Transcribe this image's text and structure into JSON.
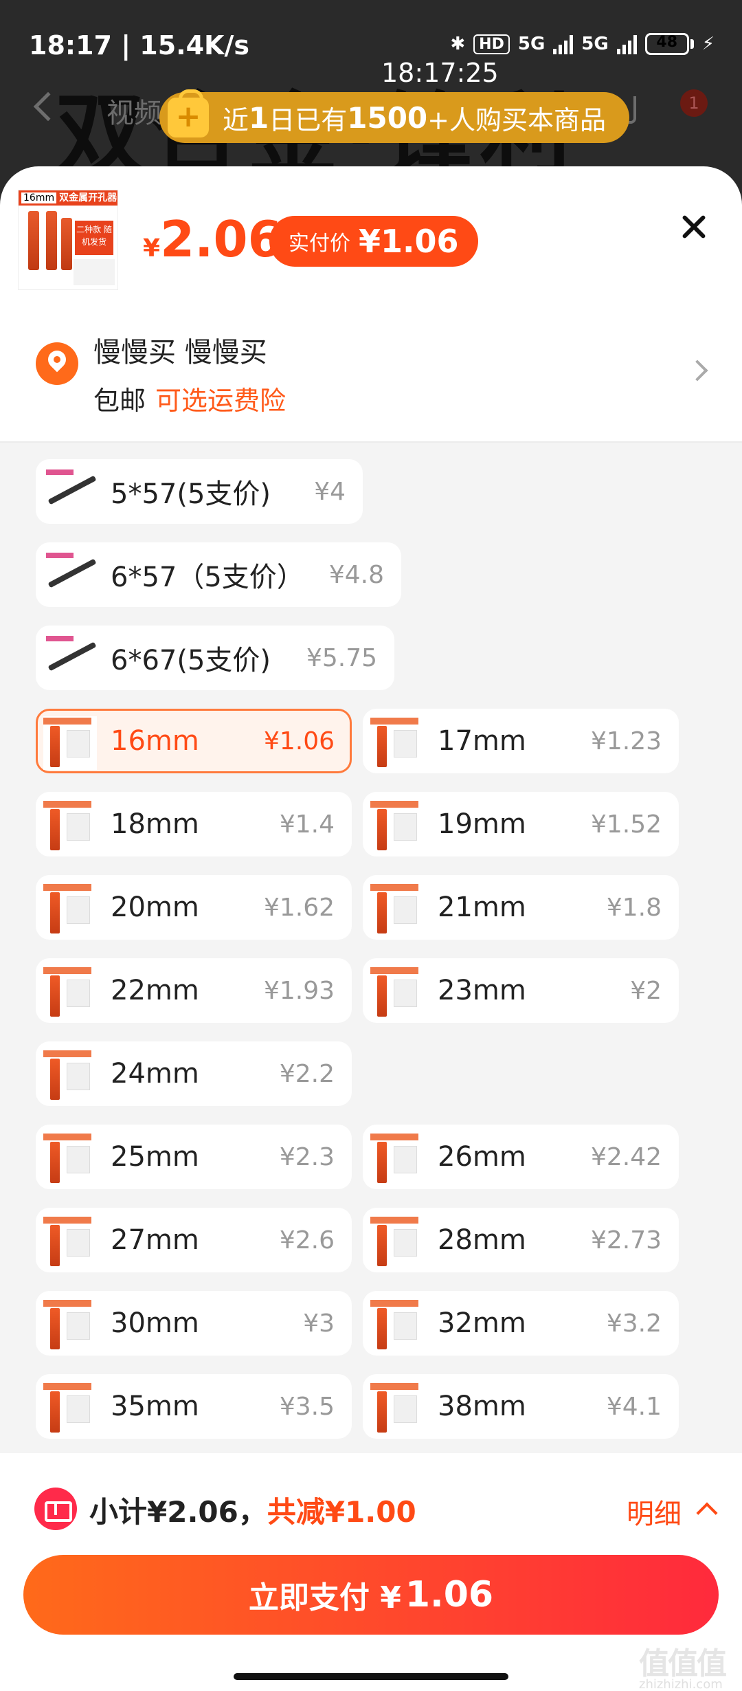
{
  "status_bar": {
    "time_speed": "18:17 | 15.4K/s",
    "clock": "18:17:25",
    "net1": "5G",
    "net2": "5G",
    "hd": "HD",
    "battery": "48"
  },
  "background": {
    "title": "双合金·锋利",
    "video_tab": "视频",
    "cart_badge": "1"
  },
  "banner": {
    "prefix": "近",
    "days": "1",
    "mid": "日已有",
    "count": "1500",
    "suffix": "+人购买本商品"
  },
  "product": {
    "thumb_size_label": "16mm",
    "thumb_title": "双金属开孔器",
    "thumb_tag": "二种款 随机发货",
    "currency": "¥",
    "price": "2.06",
    "real_price_label": "实付价",
    "real_price": "¥1.06"
  },
  "address": {
    "name": "慢慢买 慢慢买",
    "shipping": "包邮",
    "insurance": "可选运费险"
  },
  "options": [
    {
      "name": "5*57(5支价)",
      "price": "¥4",
      "kind": "pin",
      "selected": false
    },
    {
      "name": "6*57（5支价）",
      "price": "¥4.8",
      "kind": "pin",
      "selected": false
    },
    {
      "name": "6*67(5支价)",
      "price": "¥5.75",
      "kind": "pin",
      "selected": false
    },
    {
      "name": "16mm",
      "price": "¥1.06",
      "kind": "saw",
      "selected": true
    },
    {
      "name": "17mm",
      "price": "¥1.23",
      "kind": "saw",
      "selected": false
    },
    {
      "name": "18mm",
      "price": "¥1.4",
      "kind": "saw",
      "selected": false
    },
    {
      "name": "19mm",
      "price": "¥1.52",
      "kind": "saw",
      "selected": false
    },
    {
      "name": "20mm",
      "price": "¥1.62",
      "kind": "saw",
      "selected": false
    },
    {
      "name": "21mm",
      "price": "¥1.8",
      "kind": "saw",
      "selected": false
    },
    {
      "name": "22mm",
      "price": "¥1.93",
      "kind": "saw",
      "selected": false
    },
    {
      "name": "23mm",
      "price": "¥2",
      "kind": "saw",
      "selected": false
    },
    {
      "name": "24mm",
      "price": "¥2.2",
      "kind": "saw",
      "selected": false
    },
    {
      "name": "25mm",
      "price": "¥2.3",
      "kind": "saw",
      "selected": false
    },
    {
      "name": "26mm",
      "price": "¥2.42",
      "kind": "saw",
      "selected": false
    },
    {
      "name": "27mm",
      "price": "¥2.6",
      "kind": "saw",
      "selected": false
    },
    {
      "name": "28mm",
      "price": "¥2.73",
      "kind": "saw",
      "selected": false
    },
    {
      "name": "30mm",
      "price": "¥3",
      "kind": "saw",
      "selected": false
    },
    {
      "name": "32mm",
      "price": "¥3.2",
      "kind": "saw",
      "selected": false
    },
    {
      "name": "35mm",
      "price": "¥3.5",
      "kind": "saw",
      "selected": false
    },
    {
      "name": "38mm",
      "price": "¥4.1",
      "kind": "saw",
      "selected": false
    }
  ],
  "bottom": {
    "subtotal": "小计¥2.06，",
    "discount": "共减¥1.00",
    "detail": "明细",
    "pay_label": "立即支付 ¥",
    "pay_amount": "1.06"
  },
  "watermark": {
    "logo": "值值值",
    "domain": "zhizhizhi.com"
  },
  "colors": {
    "accent": "#ff4a15",
    "banner": "#d99a1c",
    "selected_bg": "#fff3ec"
  }
}
